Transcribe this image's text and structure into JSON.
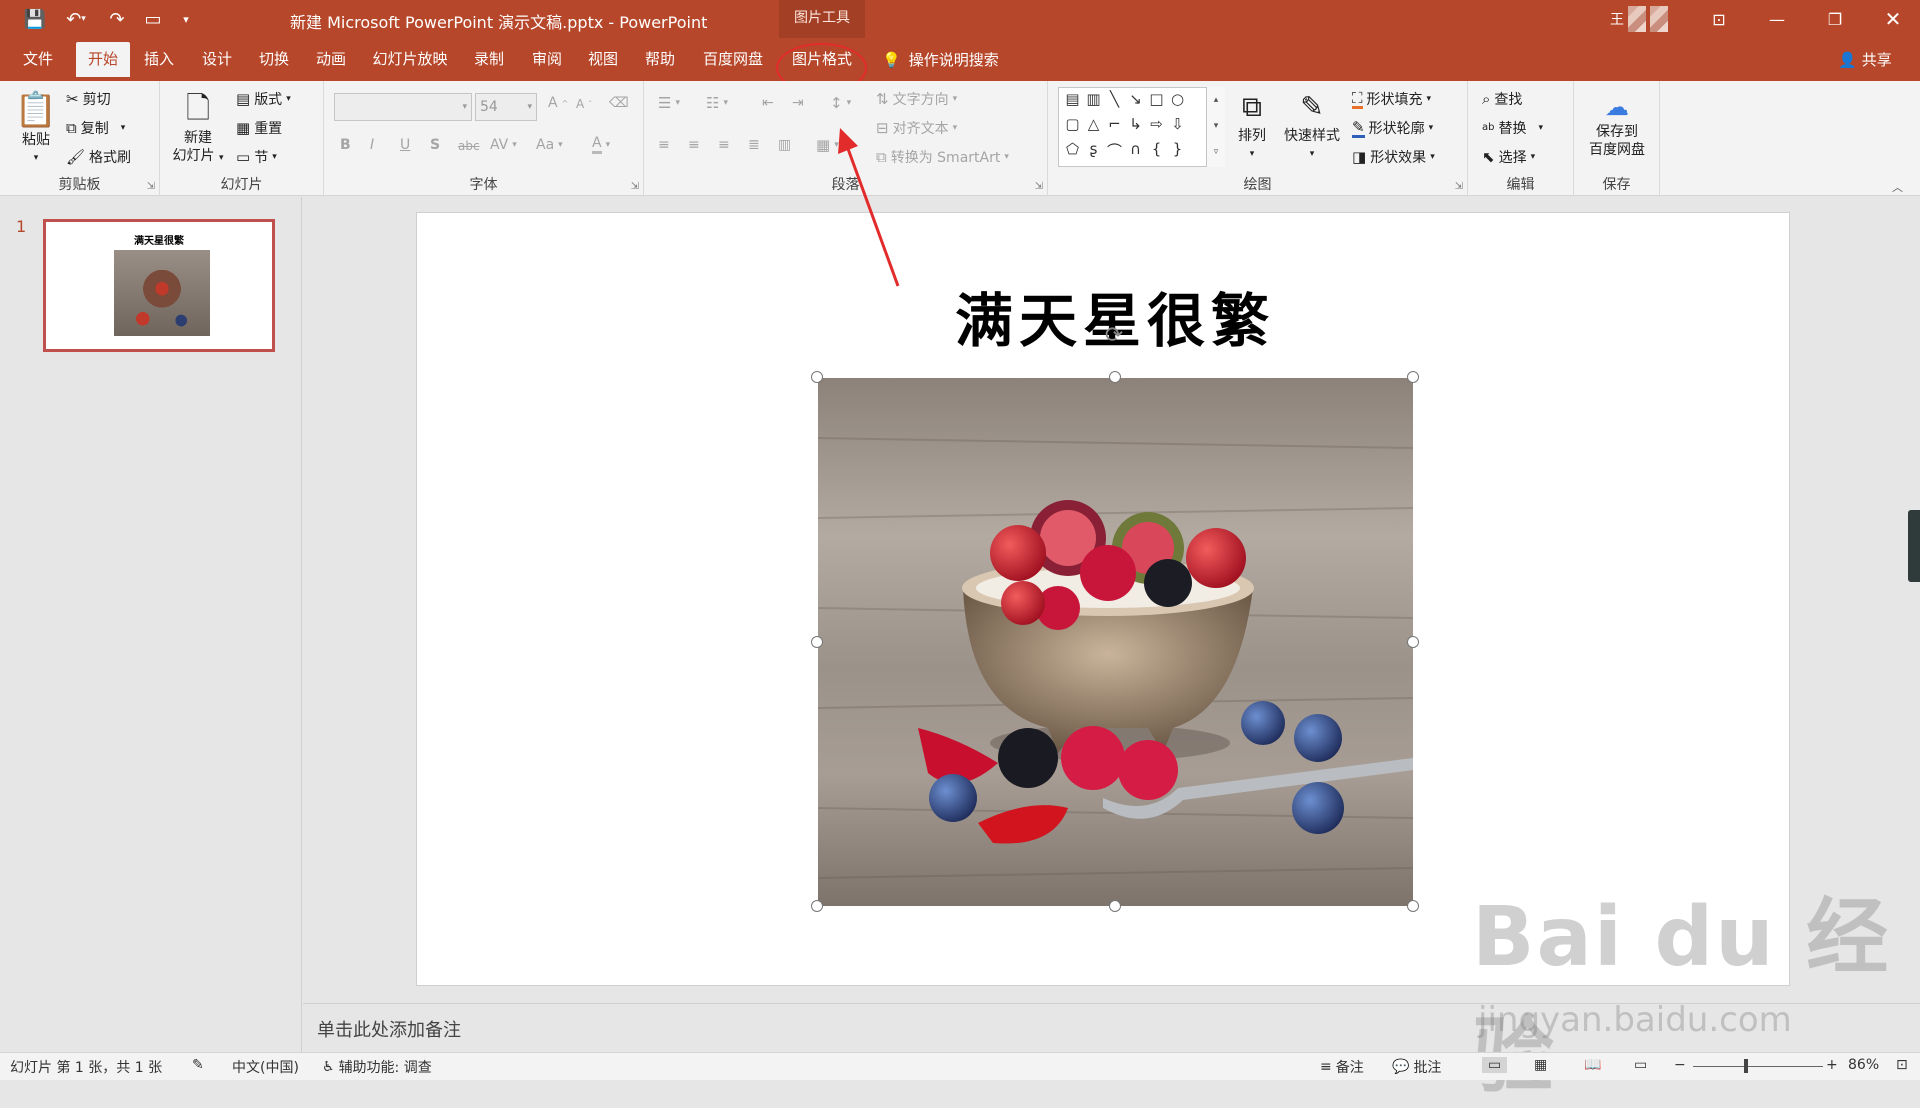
{
  "window": {
    "title": "新建 Microsoft PowerPoint 演示文稿.pptx  -  PowerPoint",
    "context_group": "图片工具",
    "user_initial": "王"
  },
  "tabs": [
    "文件",
    "开始",
    "插入",
    "设计",
    "切换",
    "动画",
    "幻灯片放映",
    "录制",
    "审阅",
    "视图",
    "帮助",
    "百度网盘",
    "图片格式"
  ],
  "active_tab": "开始",
  "tell_me": "操作说明搜索",
  "share": "共享",
  "ribbon": {
    "clipboard": {
      "label": "剪贴板",
      "paste": "粘贴",
      "cut": "剪切",
      "copy": "复制",
      "format_painter": "格式刷"
    },
    "slides": {
      "label": "幻灯片",
      "new_slide_line1": "新建",
      "new_slide_line2": "幻灯片",
      "layout": "版式",
      "reset": "重置",
      "section": "节"
    },
    "font": {
      "label": "字体",
      "font_name": "",
      "font_size": "54",
      "bold": "B",
      "italic": "I",
      "underline": "U",
      "shadow": "S",
      "strike": "abc",
      "spacing": "AV",
      "case": "Aa",
      "color": "A",
      "grow": "A",
      "shrink": "A"
    },
    "paragraph": {
      "label": "段落",
      "text_direction": "文字方向",
      "align_text": "对齐文本",
      "smartart": "转换为 SmartArt"
    },
    "drawing": {
      "label": "绘图",
      "arrange": "排列",
      "quick_styles": "快速样式",
      "shape_fill": "形状填充",
      "shape_outline": "形状轮廓",
      "shape_effects": "形状效果"
    },
    "editing": {
      "label": "编辑",
      "find": "查找",
      "replace": "替换",
      "select": "选择"
    },
    "save": {
      "label": "保存",
      "save_to_line1": "保存到",
      "save_to_line2": "百度网盘"
    }
  },
  "thumbnail": {
    "number": "1",
    "title": "满天星很繁"
  },
  "slide": {
    "title": "满天星很繁"
  },
  "notes_placeholder": "单击此处添加备注",
  "status": {
    "slide_info": "幻灯片 第 1 张，共 1 张",
    "language": "中文(中国)",
    "accessibility": "辅助功能: 调查",
    "notes": "备注",
    "comments": "批注",
    "zoom": "86%"
  },
  "watermark": {
    "brand": "Bai  du 经验",
    "url": "jingyan.baidu.com"
  },
  "colors": {
    "accent": "#b7472a",
    "annotation": "#e22b2b"
  }
}
